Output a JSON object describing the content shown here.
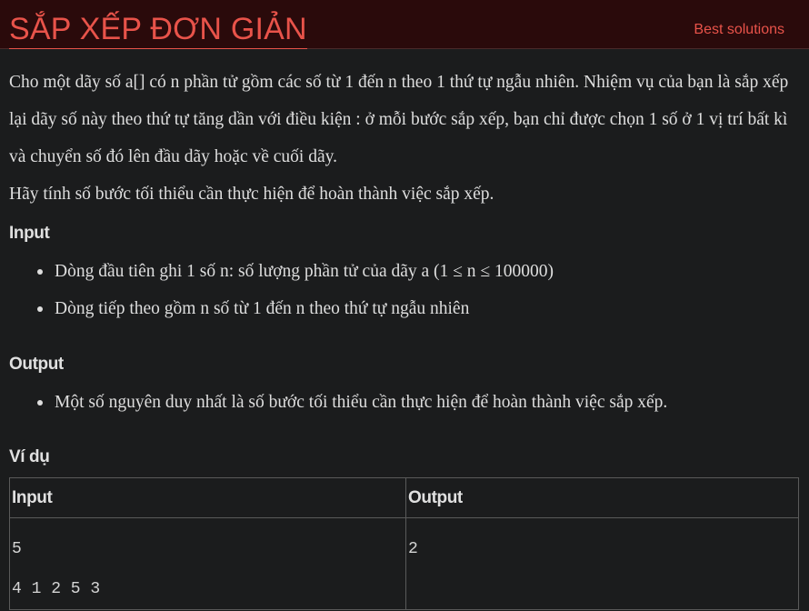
{
  "header": {
    "title": "SẮP XẾP ĐƠN GIẢN",
    "best_solutions_label": "Best solutions"
  },
  "problem": {
    "paragraphs": [
      "Cho một dãy số a[] có n phần tử gồm các số từ 1 đến n theo 1 thứ tự ngẫu nhiên. Nhiệm vụ của bạn là sắp xếp lại dãy số này theo thứ tự tăng dần với điều kiện : ở mỗi bước sắp xếp, bạn chỉ được chọn 1 số ở 1 vị trí bất kì và chuyển số đó lên đầu dãy hoặc về cuối dãy.",
      "Hãy tính số bước tối thiểu cần thực hiện để hoàn thành việc sắp xếp."
    ]
  },
  "input_section": {
    "heading": "Input",
    "items": [
      "Dòng đầu tiên ghi 1 số n: số lượng phần tử của dãy a (1 ≤ n ≤ 100000)",
      "Dòng tiếp theo gồm n số từ 1 đến n theo thứ tự ngẫu nhiên"
    ]
  },
  "output_section": {
    "heading": "Output",
    "items": [
      "Một số nguyên duy nhất là số bước tối thiểu cần thực hiện để hoàn thành việc sắp xếp."
    ]
  },
  "example": {
    "heading": "Ví dụ",
    "columns": [
      "Input",
      "Output"
    ],
    "input_lines": [
      "5",
      "4 1 2 5 3"
    ],
    "output_lines": [
      "2"
    ]
  },
  "colors": {
    "accent": "#e8534a",
    "background": "#1b1c1d",
    "header_background": "#2a0a0b"
  }
}
